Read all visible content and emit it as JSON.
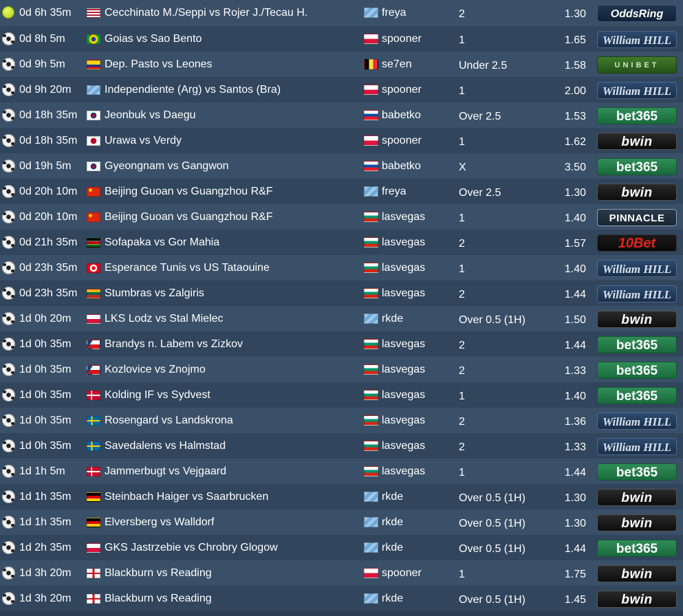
{
  "tips": [
    {
      "sport": "tennis-icon",
      "time": "0d 6h 35m",
      "match_flag": "us",
      "match": "Cecchinato M./Seppi vs Rojer J./Tecau H.",
      "tipster_flag": "unknown",
      "tipster": "freya",
      "pick": "2",
      "odds": "1.30",
      "bookmaker": "oddsring",
      "bookmaker_text": "OddsRing"
    },
    {
      "sport": "soccer-ball-icon",
      "time": "0d 8h 5m",
      "match_flag": "br",
      "match": "Goias vs Sao Bento",
      "tipster_flag": "pl",
      "tipster": "spooner",
      "pick": "1",
      "odds": "1.65",
      "bookmaker": "wh",
      "bookmaker_text": "William HILL"
    },
    {
      "sport": "soccer-ball-icon",
      "time": "0d 9h 5m",
      "match_flag": "co",
      "match": "Dep. Pasto vs Leones",
      "tipster_flag": "be",
      "tipster": "se7en",
      "pick": "Under 2.5",
      "odds": "1.58",
      "bookmaker": "unibet",
      "bookmaker_text": "UNIBET"
    },
    {
      "sport": "soccer-ball-icon",
      "time": "0d 9h 20m",
      "match_flag": "unknown",
      "match": "Independiente (Arg) vs Santos (Bra)",
      "tipster_flag": "pl",
      "tipster": "spooner",
      "pick": "1",
      "odds": "2.00",
      "bookmaker": "wh",
      "bookmaker_text": "William HILL"
    },
    {
      "sport": "soccer-ball-icon",
      "time": "0d 18h 35m",
      "match_flag": "kr",
      "match": "Jeonbuk vs Daegu",
      "tipster_flag": "sk",
      "tipster": "babetko",
      "pick": "Over 2.5",
      "odds": "1.53",
      "bookmaker": "bet365",
      "bookmaker_text": "bet365"
    },
    {
      "sport": "soccer-ball-icon",
      "time": "0d 18h 35m",
      "match_flag": "jp",
      "match": "Urawa vs Verdy",
      "tipster_flag": "pl",
      "tipster": "spooner",
      "pick": "1",
      "odds": "1.62",
      "bookmaker": "bwin",
      "bookmaker_text": "bwin"
    },
    {
      "sport": "soccer-ball-icon",
      "time": "0d 19h 5m",
      "match_flag": "kr",
      "match": "Gyeongnam vs Gangwon",
      "tipster_flag": "sk",
      "tipster": "babetko",
      "pick": "X",
      "odds": "3.50",
      "bookmaker": "bet365",
      "bookmaker_text": "bet365"
    },
    {
      "sport": "soccer-ball-icon",
      "time": "0d 20h 10m",
      "match_flag": "cn",
      "match": "Beijing Guoan vs Guangzhou R&F",
      "tipster_flag": "unknown",
      "tipster": "freya",
      "pick": "Over 2.5",
      "odds": "1.30",
      "bookmaker": "bwin",
      "bookmaker_text": "bwin"
    },
    {
      "sport": "soccer-ball-icon",
      "time": "0d 20h 10m",
      "match_flag": "cn",
      "match": "Beijing Guoan vs Guangzhou R&F",
      "tipster_flag": "bg",
      "tipster": "lasvegas",
      "pick": "1",
      "odds": "1.40",
      "bookmaker": "pinnacle",
      "bookmaker_text": "PINNACLE"
    },
    {
      "sport": "soccer-ball-icon",
      "time": "0d 21h 35m",
      "match_flag": "ke",
      "match": "Sofapaka vs Gor Mahia",
      "tipster_flag": "bg",
      "tipster": "lasvegas",
      "pick": "2",
      "odds": "1.57",
      "bookmaker": "10bet",
      "bookmaker_text": "10Bet"
    },
    {
      "sport": "soccer-ball-icon",
      "time": "0d 23h 35m",
      "match_flag": "tn",
      "match": "Esperance Tunis vs US Tataouine",
      "tipster_flag": "bg",
      "tipster": "lasvegas",
      "pick": "1",
      "odds": "1.40",
      "bookmaker": "wh",
      "bookmaker_text": "William HILL"
    },
    {
      "sport": "soccer-ball-icon",
      "time": "0d 23h 35m",
      "match_flag": "lt",
      "match": "Stumbras vs Zalgiris",
      "tipster_flag": "bg",
      "tipster": "lasvegas",
      "pick": "2",
      "odds": "1.44",
      "bookmaker": "wh",
      "bookmaker_text": "William HILL"
    },
    {
      "sport": "soccer-ball-icon",
      "time": "1d 0h 20m",
      "match_flag": "pl",
      "match": "LKS Lodz vs Stal Mielec",
      "tipster_flag": "unknown",
      "tipster": "rkde",
      "pick": "Over 0.5 (1H)",
      "odds": "1.50",
      "bookmaker": "bwin",
      "bookmaker_text": "bwin"
    },
    {
      "sport": "soccer-ball-icon",
      "time": "1d 0h 35m",
      "match_flag": "cz",
      "match": "Brandys n. Labem vs Zizkov",
      "tipster_flag": "bg",
      "tipster": "lasvegas",
      "pick": "2",
      "odds": "1.44",
      "bookmaker": "bet365",
      "bookmaker_text": "bet365"
    },
    {
      "sport": "soccer-ball-icon",
      "time": "1d 0h 35m",
      "match_flag": "cz",
      "match": "Kozlovice vs Znojmo",
      "tipster_flag": "bg",
      "tipster": "lasvegas",
      "pick": "2",
      "odds": "1.33",
      "bookmaker": "bet365",
      "bookmaker_text": "bet365"
    },
    {
      "sport": "soccer-ball-icon",
      "time": "1d 0h 35m",
      "match_flag": "dk",
      "match": "Kolding IF vs Sydvest",
      "tipster_flag": "bg",
      "tipster": "lasvegas",
      "pick": "1",
      "odds": "1.40",
      "bookmaker": "bet365",
      "bookmaker_text": "bet365"
    },
    {
      "sport": "soccer-ball-icon",
      "time": "1d 0h 35m",
      "match_flag": "se",
      "match": "Rosengard vs Landskrona",
      "tipster_flag": "bg",
      "tipster": "lasvegas",
      "pick": "2",
      "odds": "1.36",
      "bookmaker": "wh",
      "bookmaker_text": "William HILL"
    },
    {
      "sport": "soccer-ball-icon",
      "time": "1d 0h 35m",
      "match_flag": "se",
      "match": "Savedalens vs Halmstad",
      "tipster_flag": "bg",
      "tipster": "lasvegas",
      "pick": "2",
      "odds": "1.33",
      "bookmaker": "wh",
      "bookmaker_text": "William HILL"
    },
    {
      "sport": "soccer-ball-icon",
      "time": "1d 1h 5m",
      "match_flag": "dk",
      "match": "Jammerbugt vs Vejgaard",
      "tipster_flag": "bg",
      "tipster": "lasvegas",
      "pick": "1",
      "odds": "1.44",
      "bookmaker": "bet365",
      "bookmaker_text": "bet365"
    },
    {
      "sport": "soccer-ball-icon",
      "time": "1d 1h 35m",
      "match_flag": "de",
      "match": "Steinbach Haiger vs Saarbrucken",
      "tipster_flag": "unknown",
      "tipster": "rkde",
      "pick": "Over 0.5 (1H)",
      "odds": "1.30",
      "bookmaker": "bwin",
      "bookmaker_text": "bwin"
    },
    {
      "sport": "soccer-ball-icon",
      "time": "1d 1h 35m",
      "match_flag": "de",
      "match": "Elversberg vs Walldorf",
      "tipster_flag": "unknown",
      "tipster": "rkde",
      "pick": "Over 0.5 (1H)",
      "odds": "1.30",
      "bookmaker": "bwin",
      "bookmaker_text": "bwin"
    },
    {
      "sport": "soccer-ball-icon",
      "time": "1d 2h 35m",
      "match_flag": "pl",
      "match": "GKS Jastrzebie vs Chrobry Glogow",
      "tipster_flag": "unknown",
      "tipster": "rkde",
      "pick": "Over 0.5 (1H)",
      "odds": "1.44",
      "bookmaker": "bet365",
      "bookmaker_text": "bet365"
    },
    {
      "sport": "soccer-ball-icon",
      "time": "1d 3h 20m",
      "match_flag": "en",
      "match": "Blackburn vs Reading",
      "tipster_flag": "pl",
      "tipster": "spooner",
      "pick": "1",
      "odds": "1.75",
      "bookmaker": "bwin",
      "bookmaker_text": "bwin"
    },
    {
      "sport": "soccer-ball-icon",
      "time": "1d 3h 20m",
      "match_flag": "en",
      "match": "Blackburn vs Reading",
      "tipster_flag": "unknown",
      "tipster": "rkde",
      "pick": "Over 0.5 (1H)",
      "odds": "1.45",
      "bookmaker": "bwin",
      "bookmaker_text": "bwin"
    }
  ]
}
